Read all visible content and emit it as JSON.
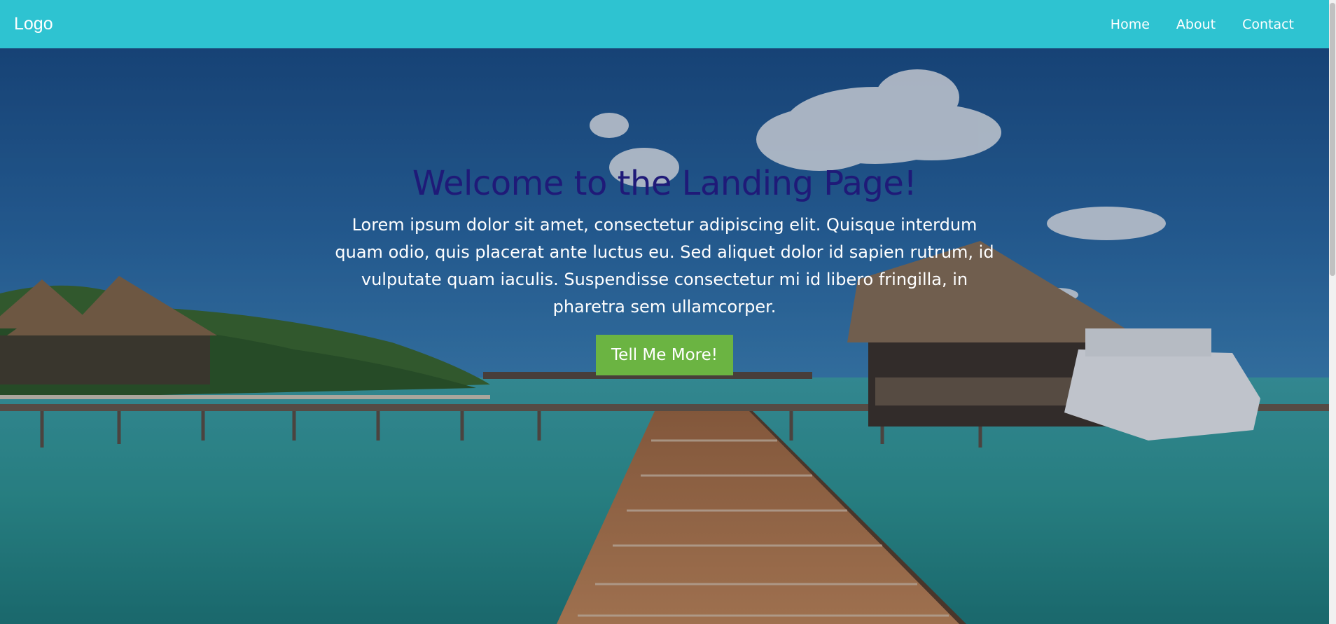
{
  "navbar": {
    "logo": "Logo",
    "links": [
      "Home",
      "About",
      "Contact"
    ]
  },
  "hero": {
    "title": "Welcome to the Landing Page!",
    "text": "Lorem ipsum dolor sit amet, consectetur adipiscing elit. Quisque interdum quam odio, quis placerat ante luctus eu. Sed aliquet dolor id sapien rutrum, id vulputate quam iaculis. Suspendisse consectetur mi id libero fringilla, in pharetra sem ullamcorper.",
    "button_label": "Tell Me More!"
  },
  "colors": {
    "navbar": "#2ec3d1",
    "title": "#1f1a78",
    "button": "#6bb442"
  }
}
